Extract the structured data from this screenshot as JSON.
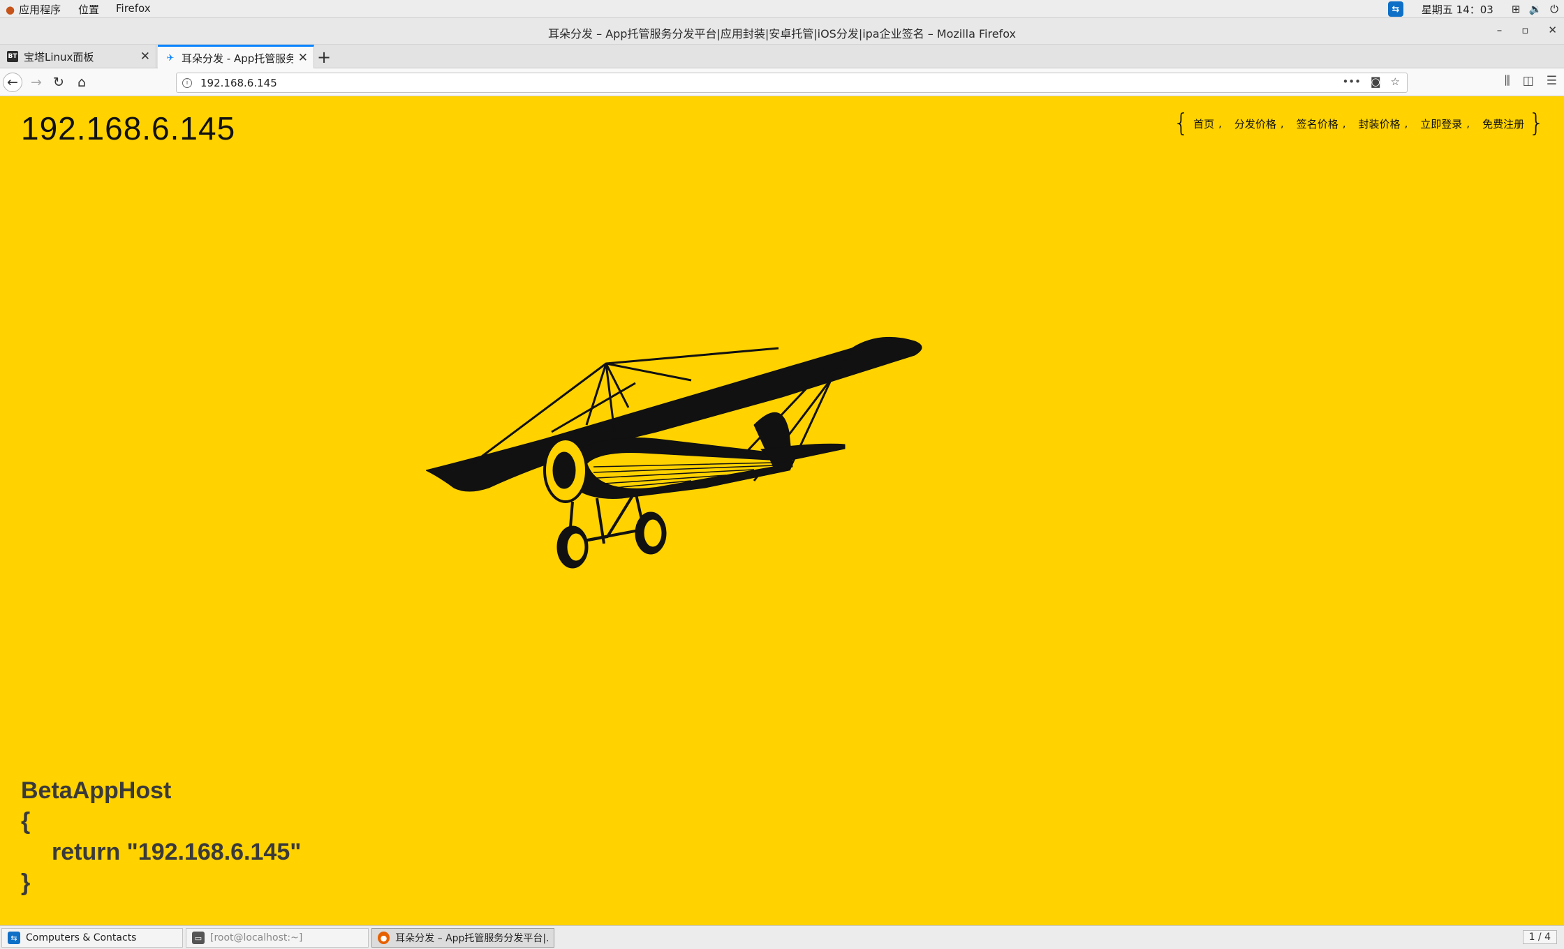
{
  "system_bar": {
    "apps_menu": "应用程序",
    "places_menu": "位置",
    "active_app": "Firefox",
    "clock": "星期五 14：03"
  },
  "window": {
    "title": "耳朵分发 – App托管服务分发平台|应用封装|安卓托管|iOS分发|ipa企业签名 – Mozilla Firefox",
    "minimize": "–",
    "maximize": "▫",
    "close": "✕"
  },
  "tabs": [
    {
      "favicon": "BT",
      "label": "宝塔Linux面板"
    },
    {
      "favicon": "✈",
      "label": "耳朵分发 - App托管服务"
    }
  ],
  "url": "192.168.6.145",
  "page": {
    "site_title": "192.168.6.145",
    "nav": [
      "首页",
      "分发价格",
      "签名价格",
      "封装价格",
      "立即登录",
      "免费注册"
    ],
    "code_lines": [
      "BetaAppHost",
      "{",
      "return \"192.168.6.145\"",
      "}"
    ]
  },
  "taskbar": {
    "items": [
      "Computers & Contacts",
      "[root@localhost:~]",
      "耳朵分发 – App托管服务分发平台|..."
    ],
    "workspace": "1 / 4"
  },
  "colors": {
    "page_background": "#ffd200",
    "active_tab_accent": "#0a84ff"
  }
}
